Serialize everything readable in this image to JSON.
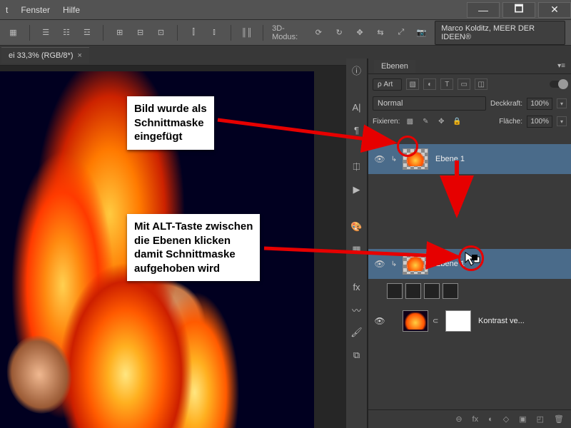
{
  "titlebar": {
    "menus": [
      "t",
      "Fenster",
      "Hilfe"
    ]
  },
  "winbtns": {
    "min": "—",
    "max": "🗖",
    "close": "✕"
  },
  "optbar": {
    "mode3d_label": "3D-Modus:",
    "workspace": "Marco Kolditz, MEER DER IDEEN®"
  },
  "doctab": {
    "title": "ei 33,3% (RGB/8*)",
    "close": "×"
  },
  "panel": {
    "tab": "Ebenen",
    "filter_label": "ρ Art",
    "blend": "Normal",
    "opacity_label": "Deckkraft:",
    "opacity_val": "100%",
    "lock_label": "Fixieren:",
    "fill_label": "Fläche:",
    "fill_val": "100%"
  },
  "layers": {
    "top": {
      "name": "Ebene 1"
    },
    "mid": {
      "name": "Ebene 1"
    },
    "bot": {
      "name": "Kontrast ve..."
    }
  },
  "anno": {
    "box1_l1": "Bild wurde als",
    "box1_l2": "Schnittmaske",
    "box1_l3": "eingefügt",
    "box2_l1": "Mit ALT-Taste zwischen",
    "box2_l2": "die Ebenen klicken",
    "box2_l3": "damit Schnittmaske",
    "box2_l4": "aufgehoben wird"
  },
  "footer_icons": [
    "⊖",
    "fx",
    "◐",
    "◇",
    "▣",
    "◰",
    "🗑"
  ]
}
